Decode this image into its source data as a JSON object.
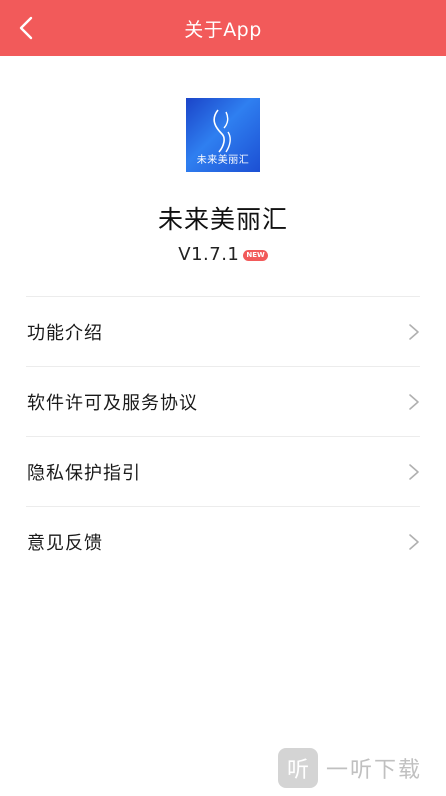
{
  "header": {
    "title": "关于App"
  },
  "app": {
    "name": "未来美丽汇",
    "logo_text": "未来美丽汇",
    "version": "V1.7.1",
    "badge": "NEW"
  },
  "menu": {
    "items": [
      {
        "label": "功能介绍"
      },
      {
        "label": "软件许可及服务协议"
      },
      {
        "label": "隐私保护指引"
      },
      {
        "label": "意见反馈"
      }
    ]
  },
  "watermark": {
    "text": "一听下载",
    "icon_glyph": "听"
  },
  "colors": {
    "accent": "#f25a5a",
    "logo_blue": "#2f7ff0"
  }
}
